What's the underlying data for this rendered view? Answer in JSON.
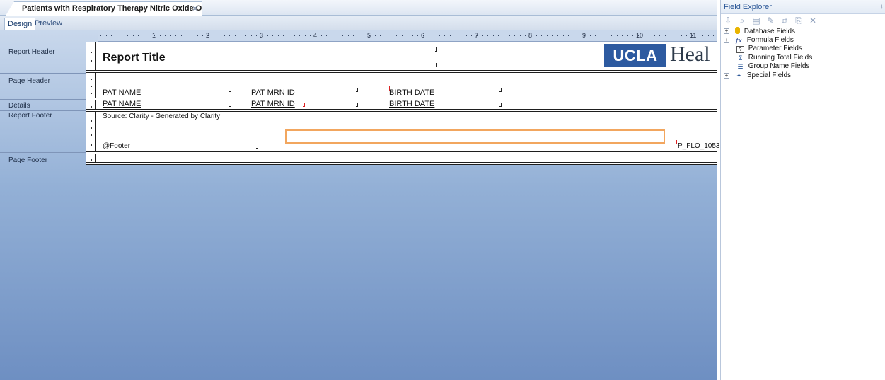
{
  "document_tab": {
    "title": "Patients with Respiratory Therapy Nitric Oxide Orders",
    "close": "×"
  },
  "view_tabs": {
    "design": "Design",
    "preview": "Preview"
  },
  "sections": {
    "report_header": "Report Header",
    "page_header": "Page Header",
    "details": "Details",
    "report_footer": "Report Footer",
    "page_footer": "Page Footer"
  },
  "ruler_numbers": [
    "1",
    "2",
    "3",
    "4",
    "5",
    "6",
    "7",
    "8",
    "9",
    "10",
    "11"
  ],
  "report_header": {
    "title": "Report Title",
    "logo_ucla": "UCLA",
    "logo_health": "Heal"
  },
  "page_header": {
    "col1": "PAT NAME",
    "col2": "PAT MRN ID",
    "col3": "BIRTH DATE"
  },
  "details": {
    "col1": "PAT NAME",
    "col2": "PAT MRN ID",
    "col3": "BIRTH DATE"
  },
  "report_footer": {
    "source": "Source: Clarity - Generated by Clarity",
    "footer_formula": "@Footer",
    "param_field": "P_FLO_1053"
  },
  "field_explorer": {
    "title": "Field Explorer",
    "pin": "↓",
    "items": [
      {
        "label": "Database Fields",
        "icon": "database-icon",
        "expandable": true
      },
      {
        "label": "Formula Fields",
        "icon": "formula-icon",
        "expandable": true
      },
      {
        "label": "Parameter Fields",
        "icon": "parameter-icon",
        "expandable": false
      },
      {
        "label": "Running Total Fields",
        "icon": "running-total-icon",
        "expandable": false
      },
      {
        "label": "Group Name Fields",
        "icon": "group-name-icon",
        "expandable": false
      },
      {
        "label": "Special Fields",
        "icon": "special-fields-icon",
        "expandable": true
      }
    ]
  },
  "colors": {
    "accent": "#2b5797",
    "logo_blue": "#2d5aa0",
    "highlight_box": "#f2a65e"
  }
}
